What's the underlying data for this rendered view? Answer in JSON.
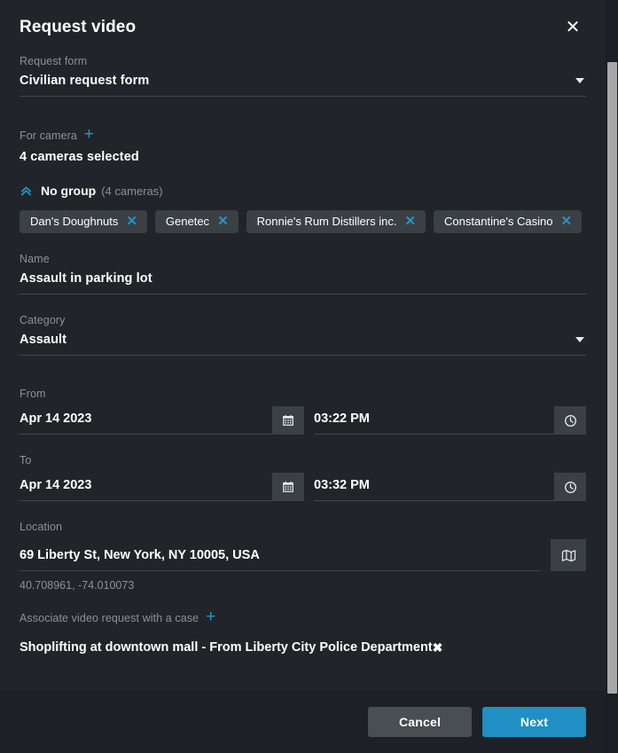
{
  "dialog": {
    "title": "Request video",
    "close_icon": "close-icon"
  },
  "request_form": {
    "label": "Request form",
    "value": "Civilian request form",
    "caret_icon": "chevron-down-icon"
  },
  "for_camera": {
    "label": "For camera",
    "add_icon": "plus-icon",
    "summary": "4 cameras selected",
    "group": {
      "collapse_icon": "chevron-double-up-icon",
      "name": "No group",
      "count": "(4 cameras)"
    },
    "chips": [
      {
        "label": "Dan's Doughnuts",
        "remove_icon": "close-icon"
      },
      {
        "label": "Genetec",
        "remove_icon": "close-icon"
      },
      {
        "label": "Ronnie's Rum Distillers inc.",
        "remove_icon": "close-icon"
      },
      {
        "label": "Constantine's Casino",
        "remove_icon": "close-icon"
      }
    ]
  },
  "name": {
    "label": "Name",
    "value": "Assault in parking lot"
  },
  "category": {
    "label": "Category",
    "value": "Assault",
    "caret_icon": "chevron-down-icon"
  },
  "from": {
    "label": "From",
    "date": "Apr 14 2023",
    "time": "03:22 PM",
    "date_icon": "calendar-icon",
    "time_icon": "clock-icon"
  },
  "to": {
    "label": "To",
    "date": "Apr 14 2023",
    "time": "03:32 PM",
    "date_icon": "calendar-icon",
    "time_icon": "clock-icon"
  },
  "location": {
    "label": "Location",
    "address": "69 Liberty St, New York, NY 10005, USA",
    "coordinates": "40.708961, -74.010073",
    "map_icon": "map-icon"
  },
  "case": {
    "label": "Associate video request with a case",
    "add_icon": "plus-icon",
    "name": "Shoplifting at downtown mall - From Liberty City Police Department",
    "remove_icon": "close-icon"
  },
  "footer": {
    "cancel_label": "Cancel",
    "next_label": "Next"
  },
  "colors": {
    "accent": "#2196c9",
    "primary_button": "#1f8fc4",
    "background": "#212529",
    "chip_background": "#3b4045",
    "muted_text": "#8d9197"
  }
}
